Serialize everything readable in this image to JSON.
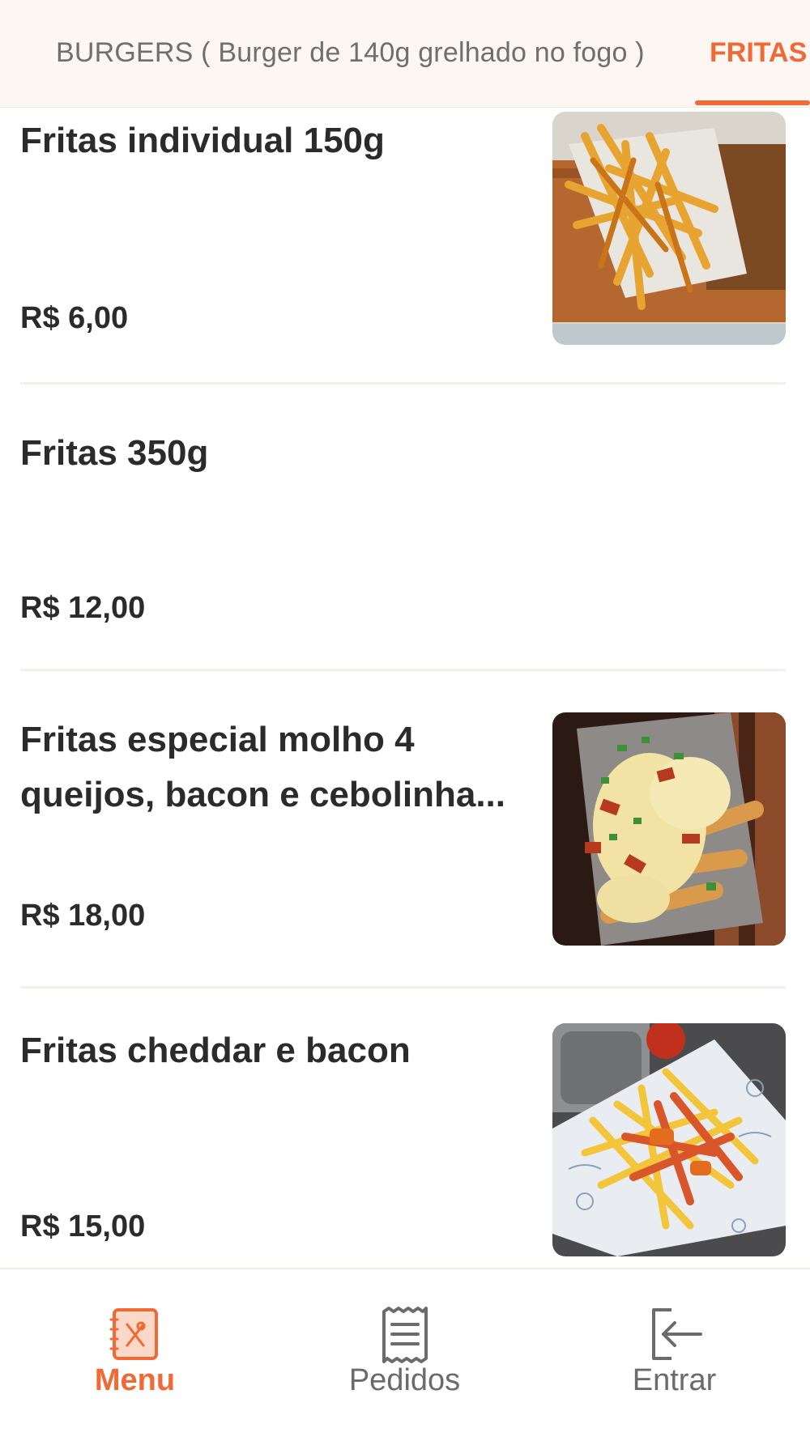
{
  "category_tabs": [
    {
      "label": "BURGERS ( Burger de 140g grelhado no fogo )",
      "active": false
    },
    {
      "label": "FRITAS",
      "active": true
    }
  ],
  "products": [
    {
      "name": "Fritas individual 150g",
      "price": "R$ 6,00",
      "image": "fries-basket-photo"
    },
    {
      "name": "Fritas 350g",
      "price": "R$ 12,00",
      "image": null
    },
    {
      "name": "Fritas especial molho 4 queijos, bacon e cebolinha...",
      "price": "R$ 18,00",
      "image": "fries-cheese-bacon-photo"
    },
    {
      "name": "Fritas cheddar e bacon",
      "price": "R$ 15,00",
      "image": "fries-cheddar-photo"
    }
  ],
  "bottom_nav": [
    {
      "label": "Menu",
      "icon": "menu-book-icon",
      "active": true
    },
    {
      "label": "Pedidos",
      "icon": "receipt-icon",
      "active": false
    },
    {
      "label": "Entrar",
      "icon": "login-icon",
      "active": false
    }
  ],
  "colors": {
    "accent": "#f06a35",
    "text": "#2b2b2b",
    "muted": "#6b6b6b",
    "tabbar_bg": "#fdf7f3"
  }
}
